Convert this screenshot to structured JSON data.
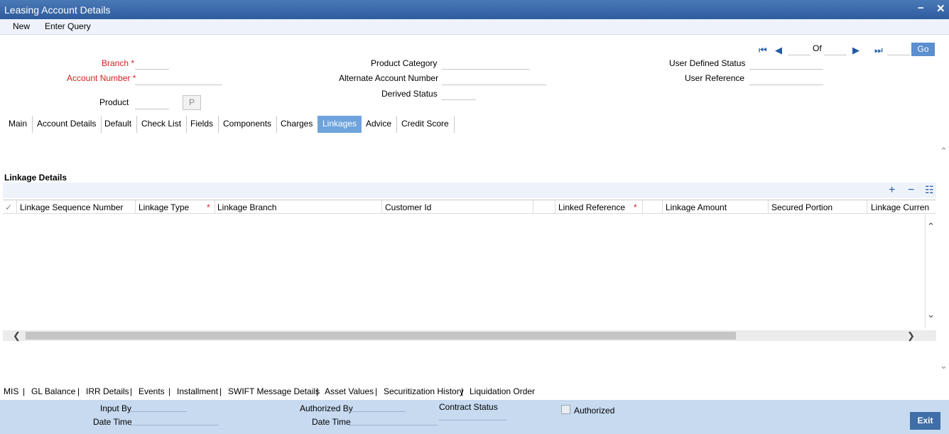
{
  "window": {
    "title": "Leasing Account Details",
    "minimize": "−",
    "close": "✕"
  },
  "menu": {
    "new": "New",
    "enter_query": "Enter Query"
  },
  "header": {
    "branch_label": "Branch",
    "account_number_label": "Account Number",
    "product_label": "Product",
    "product_button": "P",
    "product_category_label": "Product Category",
    "alternate_account_label": "Alternate Account Number",
    "derived_status_label": "Derived Status",
    "user_defined_status_label": "User Defined Status",
    "user_reference_label": "User Reference",
    "required_mark": "*"
  },
  "pager": {
    "of_label": "Of",
    "go_label": "Go"
  },
  "tabs": [
    "Main",
    "Account Details",
    "Default",
    "Check List",
    "Fields",
    "Components",
    "Charges",
    "Linkages",
    "Advice",
    "Credit Score"
  ],
  "active_tab": "Linkages",
  "linkages": {
    "title": "Linkage Details",
    "columns": {
      "seq": "Linkage Sequence Number",
      "type": "Linkage Type",
      "branch": "Linkage Branch",
      "customer": "Customer Id",
      "reference": "Linked Reference",
      "amount": "Linkage Amount",
      "secured": "Secured Portion",
      "currency": "Linkage Curren"
    }
  },
  "bottom_links": [
    "MIS",
    "GL Balance",
    "IRR Details",
    "Events",
    "Installment",
    "SWIFT Message Details",
    "Asset Values",
    "Securitization History",
    "Liquidation Order"
  ],
  "footer": {
    "input_by": "Input By",
    "date_time": "Date Time",
    "authorized_by": "Authorized By",
    "date_time_2": "Date Time",
    "contract_status": "Contract Status",
    "authorized": "Authorized",
    "exit": "Exit"
  },
  "colors": {
    "title_bar": "#2d5b9c",
    "active_tab": "#6fa3dc",
    "footer": "#c7daf0",
    "required": "#d62020"
  }
}
